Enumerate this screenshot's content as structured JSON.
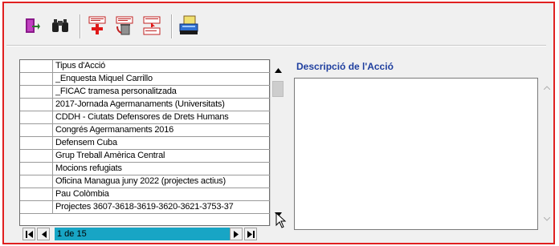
{
  "toolbar": {
    "buttons": [
      {
        "name": "exit-door-icon",
        "title": "Sortir"
      },
      {
        "name": "binoculars-search-icon",
        "title": "Cercar"
      },
      {
        "name": "add-record-icon",
        "title": "Afegir"
      },
      {
        "name": "delete-record-icon",
        "title": "Esborrar"
      },
      {
        "name": "edit-record-icon",
        "title": "Modificar"
      },
      {
        "name": "print-report-icon",
        "title": "Imprimir"
      }
    ]
  },
  "grid": {
    "header": "Tipus d'Acció",
    "rows": [
      "_Enquesta Miquel Carrillo",
      "_FICAC tramesa personalitzada",
      "2017-Jornada Agermanaments (Universitats)",
      "CDDH - Ciutats Defensores de Drets Humans",
      "Congrés Agermanaments 2016",
      "Defensem Cuba",
      "Grup Treball Amèrica Central",
      "Mocions refugiats",
      "Oficina Managua juny 2022 (projectes actius)",
      "Pau Colòmbia",
      "Projectes 3607-3618-3619-3620-3621-3753-37"
    ]
  },
  "navigator": {
    "position": "1 de 15"
  },
  "description": {
    "label": "Descripció de l'Acció",
    "value": ""
  },
  "colors": {
    "frame_border": "#e02020",
    "nav_field": "#18a5c5",
    "label": "#1f3f9f"
  }
}
